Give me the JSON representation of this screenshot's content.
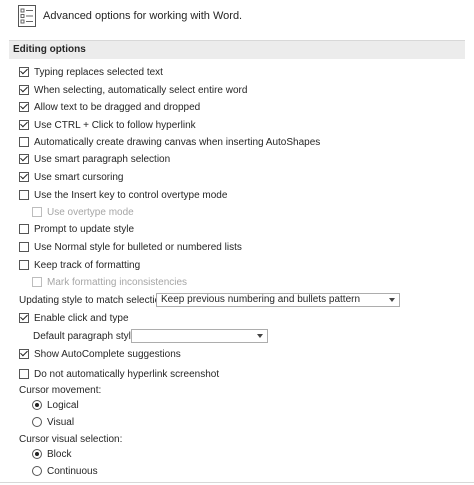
{
  "header": {
    "title": "Advanced options for working with Word.",
    "icon": "options-document-icon"
  },
  "section": {
    "title": "Editing options"
  },
  "options": {
    "typing_replaces": {
      "label": "Typing replaces selected text",
      "checked": true
    },
    "select_entire_word": {
      "label": "When selecting, automatically select entire word",
      "checked": true
    },
    "drag_drop": {
      "label": "Allow text to be dragged and dropped",
      "checked": true
    },
    "ctrl_click": {
      "label": "Use CTRL + Click to follow hyperlink",
      "checked": true
    },
    "drawing_canvas": {
      "label": "Automatically create drawing canvas when inserting AutoShapes",
      "checked": false
    },
    "smart_paragraph": {
      "label": "Use smart paragraph selection",
      "checked": true
    },
    "smart_cursoring": {
      "label": "Use smart cursoring",
      "checked": true
    },
    "insert_key": {
      "label": "Use the Insert key to control overtype mode",
      "checked": false
    },
    "overtype_mode": {
      "label": "Use overtype mode",
      "checked": false,
      "disabled": true
    },
    "prompt_style": {
      "label": "Prompt to update style",
      "checked": false
    },
    "normal_style": {
      "label": "Use Normal style for bulleted or numbered lists",
      "checked": false
    },
    "keep_track": {
      "label": "Keep track of formatting",
      "checked": false
    },
    "mark_inconsistencies": {
      "label": "Mark formatting inconsistencies",
      "checked": false,
      "disabled": true
    },
    "click_type": {
      "label": "Enable click and type",
      "checked": true
    },
    "autocomplete": {
      "label": "Show AutoComplete suggestions",
      "checked": true
    },
    "no_hyperlink": {
      "label": "Do not automatically hyperlink screenshot",
      "checked": false
    }
  },
  "updating_style": {
    "label": "Updating style to match selection:",
    "value": "Keep previous numbering and bullets pattern"
  },
  "default_paragraph": {
    "label": "Default paragraph style:",
    "value": ""
  },
  "cursor_movement": {
    "label": "Cursor movement:",
    "logical": "Logical",
    "visual": "Visual",
    "selected": "logical"
  },
  "cursor_visual_selection": {
    "label": "Cursor visual selection:",
    "block": "Block",
    "continuous": "Continuous",
    "selected": "block"
  }
}
